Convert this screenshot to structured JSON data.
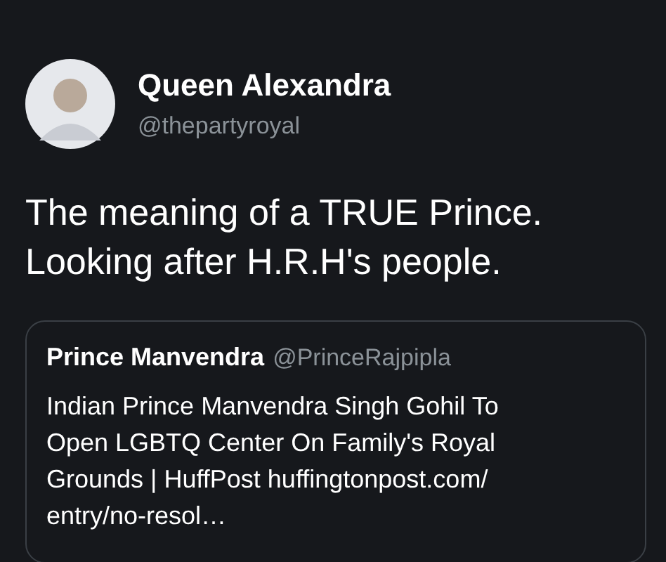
{
  "author": {
    "name": "Queen Alexandra",
    "handle": "@thepartyroyal"
  },
  "text_lines": [
    "The meaning of a TRUE Prince.",
    "Looking after H.R.H's people."
  ],
  "quote": {
    "name": "Prince Manvendra",
    "handle": "@PrinceRajpipla",
    "body_lines": [
      "Indian Prince Manvendra Singh Gohil To",
      "Open LGBTQ Center On Family's Royal",
      "Grounds | HuffPost huffingtonpost.com/",
      "entry/no-resol…"
    ]
  }
}
